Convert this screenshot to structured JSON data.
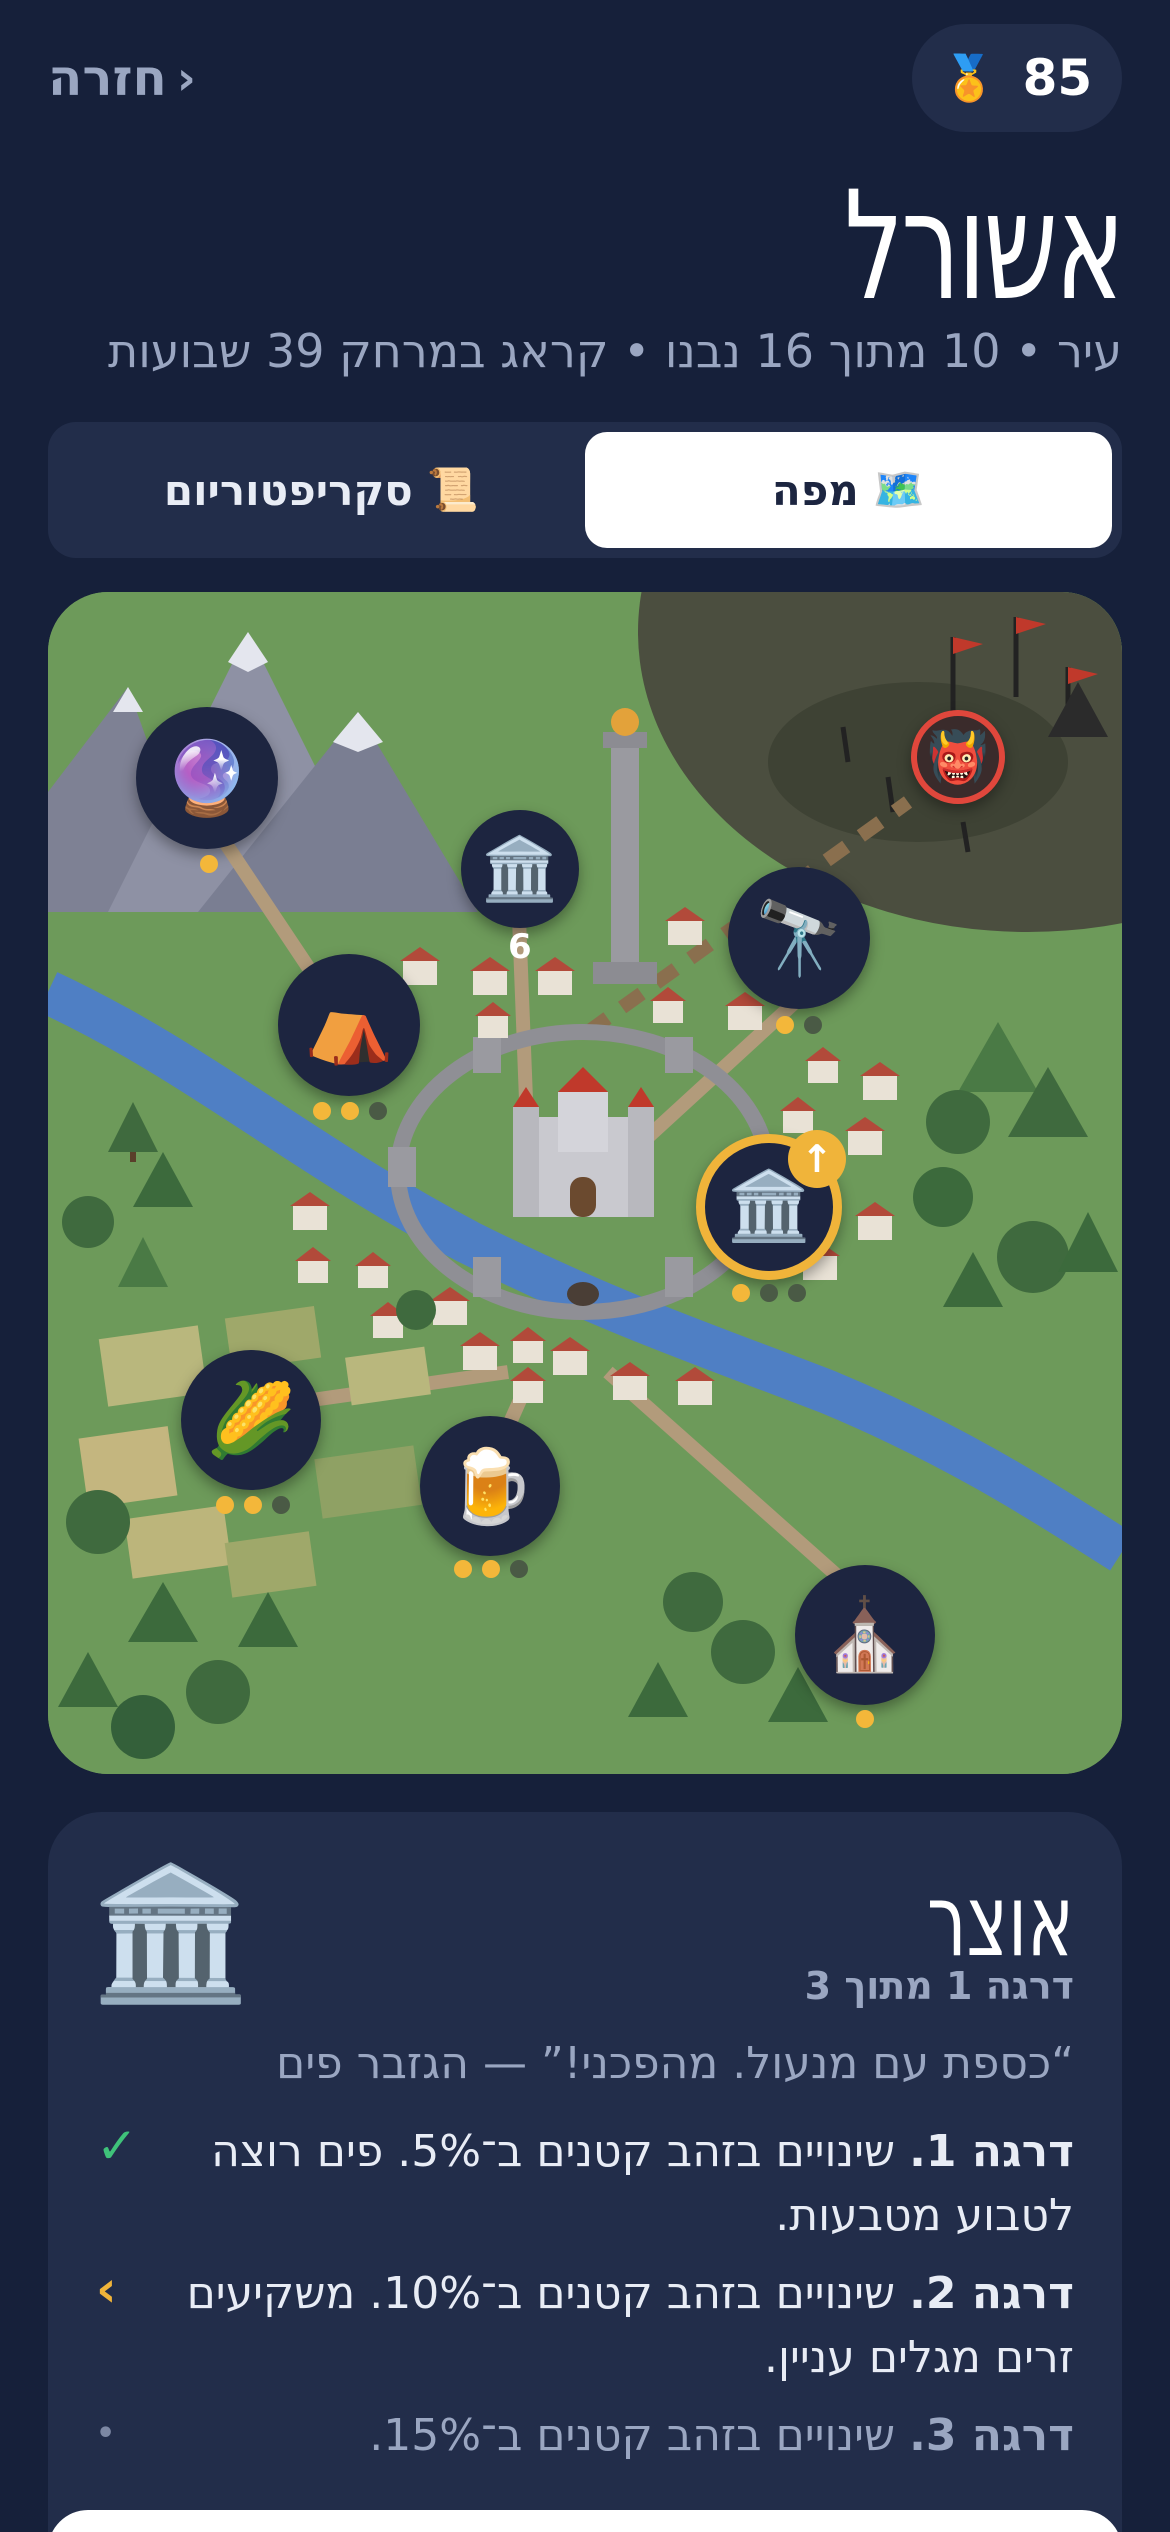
{
  "header": {
    "back_label": "חזרה",
    "back_chevron": "›",
    "score_icon": "🏅",
    "score_value": "85"
  },
  "city": {
    "name": "אשורל",
    "subtitle": "עיר • 10 מתוך 16 נבנו • קראג במרחק 39 שבועות"
  },
  "tabs": [
    {
      "label": "מפה",
      "icon": "🗺️",
      "active": true
    },
    {
      "label": "סקריפטוריום",
      "icon": "📜",
      "active": false
    }
  ],
  "map": {
    "buildings": [
      {
        "name": "crystal-ball",
        "icon": "🔮",
        "dots": [
          true
        ]
      },
      {
        "name": "museum",
        "icon": "🏛️",
        "label": "6"
      },
      {
        "name": "telescope",
        "icon": "🔭",
        "dots": [
          true,
          false
        ]
      },
      {
        "name": "tent",
        "icon": "⛺",
        "dots": [
          true,
          true,
          false
        ]
      },
      {
        "name": "treasury",
        "icon": "🏛️",
        "dots": [
          true,
          false,
          false
        ],
        "upgrade_icon": "↑"
      },
      {
        "name": "corn",
        "icon": "🌽",
        "dots": [
          true,
          true,
          false
        ]
      },
      {
        "name": "beer",
        "icon": "🍺",
        "dots": [
          true,
          true,
          false
        ]
      },
      {
        "name": "church",
        "icon": "⛪",
        "dots": [
          true
        ]
      },
      {
        "name": "enemy-camp",
        "icon": "👹"
      }
    ],
    "colors": {
      "grass": "#6d9a5a",
      "river": "#4f7fc4",
      "enemy_zone": "#4b4e3f",
      "road": "#b29b7b"
    }
  },
  "panel": {
    "icon": "🏛️",
    "title": "אוצר",
    "level_text": "דרגה 1 מתוך 3",
    "quote": "“כספת עם מנעול. מהפכני!” — הגזבר פים",
    "levels": [
      {
        "label": "דרגה 1.",
        "text": "שינויים בזהב קטנים ב־5%. פים רוצה לטבוע מטבעות.",
        "status": "done",
        "mark": "✓"
      },
      {
        "label": "דרגה 2.",
        "text": "שינויים בזהב קטנים ב־10%. משקיעים זרים מגלים עניין.",
        "status": "next",
        "mark": "›"
      },
      {
        "label": "דרגה 3.",
        "text": "שינויים בזהב קטנים ב־15%.",
        "status": "locked",
        "mark": "•"
      }
    ]
  }
}
